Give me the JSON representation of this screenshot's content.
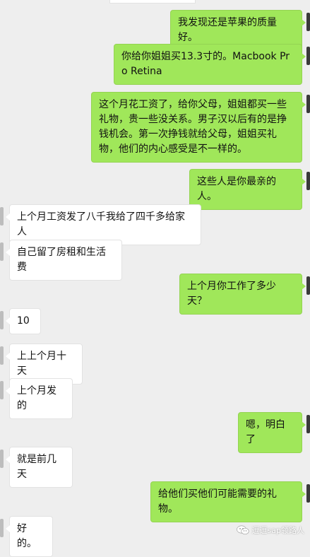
{
  "colors": {
    "background": "#eeeeee",
    "outgoing_bubble": "#a0e75a",
    "incoming_bubble": "#ffffff"
  },
  "messages": [
    {
      "dir": "out",
      "text": "我发现还是苹果的质量好。"
    },
    {
      "dir": "out",
      "text": "你给你姐姐买13.3寸的。Macbook Pro Retina"
    },
    {
      "dir": "out",
      "text": "这个月花工资了，给你父母，姐姐都买一些礼物，贵一些没关系。男子汉以后有的是挣钱机会。第一次挣钱就给父母，姐姐买礼物，他们的内心感受是不一样的。"
    },
    {
      "dir": "out",
      "text": "这些人是你最亲的人。"
    },
    {
      "dir": "in",
      "text": "上个月工资发了八千我给了四千多给家人"
    },
    {
      "dir": "in",
      "text": "自己留了房租和生活费"
    },
    {
      "dir": "out",
      "text": "上个月你工作了多少天？"
    },
    {
      "dir": "in",
      "text": "10"
    },
    {
      "dir": "in",
      "text": "上上个月十天"
    },
    {
      "dir": "in",
      "text": "上个月发的"
    },
    {
      "dir": "out",
      "text": "嗯，明白了"
    },
    {
      "dir": "in",
      "text": "就是前几天"
    },
    {
      "dir": "out",
      "text": "给他们买他们可能需要的礼物。"
    },
    {
      "dir": "in",
      "text": "好的。"
    }
  ],
  "watermark": {
    "icon": "wechat-icon",
    "text": "逗逗sap领路人"
  }
}
